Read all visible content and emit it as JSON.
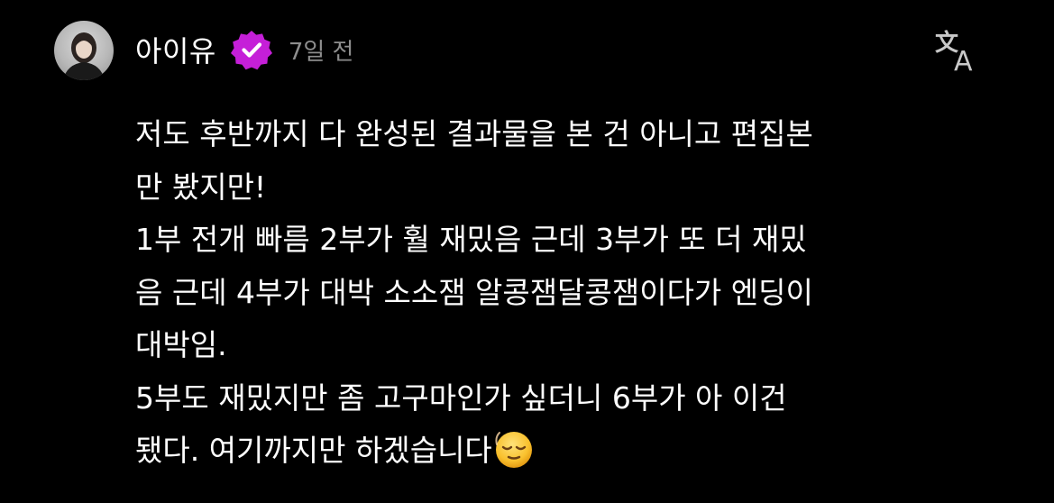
{
  "author": {
    "name": "아이유",
    "verified": true,
    "timestamp": "7일 전"
  },
  "toolbar": {
    "translate_icon": "translate-icon"
  },
  "post": {
    "lines": [
      "저도 후반까지 다 완성된 결과물을 본 건 아니고 편집본",
      "만 봤지만!",
      "1부 전개 빠름 2부가 훨 재밌음 근데 3부가 또 더 재밌",
      "음 근데 4부가 대박 소소잼 알콩잼달콩잼이다가 엔딩이",
      "대박임.",
      "5부도 재밌지만 좀 고구마인가 싶더니 6부가 아 이건",
      "됐다. 여기까지만 하겠습니다"
    ],
    "trailing_emoji": "relieved-face-emoji"
  },
  "colors": {
    "background": "#000000",
    "text": "#ffffff",
    "secondary_text": "#8e8e8e",
    "verified_badge": "#c51fd8",
    "icon": "#c8c8c8"
  }
}
